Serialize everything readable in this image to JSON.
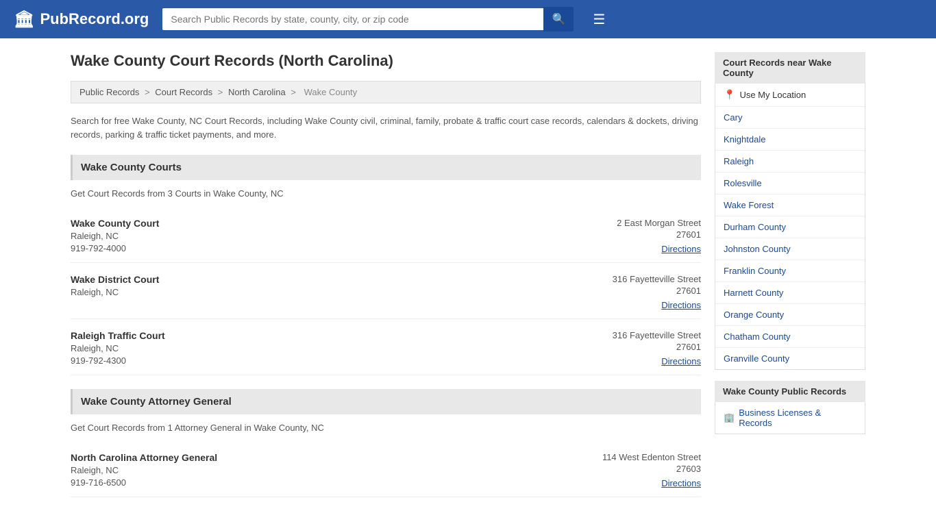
{
  "header": {
    "logo_icon": "🏛",
    "logo_text": "PubRecord.org",
    "search_placeholder": "Search Public Records by state, county, city, or zip code",
    "search_btn_icon": "🔍",
    "menu_icon": "☰"
  },
  "page": {
    "title": "Wake County Court Records (North Carolina)",
    "description": "Search for free Wake County, NC Court Records, including Wake County civil, criminal, family, probate & traffic court case records, calendars & dockets, driving records, parking & traffic ticket payments, and more."
  },
  "breadcrumb": {
    "items": [
      "Public Records",
      "Court Records",
      "North Carolina",
      "Wake County"
    ]
  },
  "courts_section": {
    "header": "Wake County Courts",
    "desc": "Get Court Records from 3 Courts in Wake County, NC",
    "entries": [
      {
        "name": "Wake County Court",
        "city_state": "Raleigh, NC",
        "phone": "919-792-4000",
        "address1": "2 East Morgan Street",
        "address2": "27601",
        "directions": "Directions"
      },
      {
        "name": "Wake District Court",
        "city_state": "Raleigh, NC",
        "phone": "",
        "address1": "316 Fayetteville Street",
        "address2": "27601",
        "directions": "Directions"
      },
      {
        "name": "Raleigh Traffic Court",
        "city_state": "Raleigh, NC",
        "phone": "919-792-4300",
        "address1": "316 Fayetteville Street",
        "address2": "27601",
        "directions": "Directions"
      }
    ]
  },
  "attorney_section": {
    "header": "Wake County Attorney General",
    "desc": "Get Court Records from 1 Attorney General in Wake County, NC",
    "entries": [
      {
        "name": "North Carolina Attorney General",
        "city_state": "Raleigh, NC",
        "phone": "919-716-6500",
        "address1": "114 West Edenton Street",
        "address2": "27603",
        "directions": "Directions"
      }
    ]
  },
  "sidebar": {
    "nearby_title": "Court Records near Wake County",
    "use_location": "Use My Location",
    "nearby_items": [
      "Cary",
      "Knightdale",
      "Raleigh",
      "Rolesville",
      "Wake Forest",
      "Durham County",
      "Johnston County",
      "Franklin County",
      "Harnett County",
      "Orange County",
      "Chatham County",
      "Granville County"
    ],
    "public_records_title": "Wake County Public Records",
    "public_records_items": [
      "Business Licenses & Records"
    ]
  }
}
